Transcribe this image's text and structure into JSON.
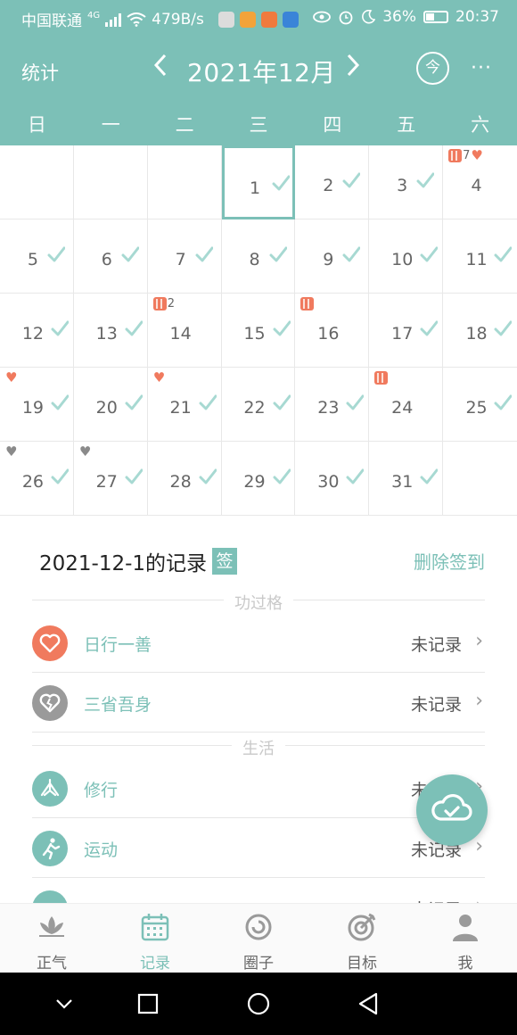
{
  "status_bar": {
    "carrier": "中国联通",
    "network": "4G",
    "speed": "479B/s",
    "battery": "36%",
    "time": "20:37"
  },
  "header": {
    "stats_label": "统计",
    "month_title": "2021年12月",
    "prev_icon": "chevron-left-icon",
    "next_icon": "chevron-right-icon",
    "today_label": "今",
    "more_label": "···"
  },
  "weekdays": [
    "日",
    "一",
    "二",
    "三",
    "四",
    "五",
    "六"
  ],
  "calendar": {
    "days": [
      "",
      "",
      "",
      "1",
      "2",
      "3",
      "4",
      "5",
      "6",
      "7",
      "8",
      "9",
      "10",
      "11",
      "12",
      "13",
      "14",
      "15",
      "16",
      "17",
      "18",
      "19",
      "20",
      "21",
      "22",
      "23",
      "24",
      "25",
      "26",
      "27",
      "28",
      "29",
      "30",
      "31",
      ""
    ],
    "selected_day": "1",
    "marker_counts": {
      "4": "7",
      "14": "2"
    }
  },
  "record": {
    "title": "2021-12-1的记录",
    "sign_badge": "签",
    "delete_label": "删除签到"
  },
  "sections": {
    "merit": "功过格",
    "life": "生活"
  },
  "rows": [
    {
      "label": "日行一善",
      "status": "未记录",
      "icon": "heart-icon"
    },
    {
      "label": "三省吾身",
      "status": "未记录",
      "icon": "broken-heart-icon"
    },
    {
      "label": "修行",
      "status": "未记录",
      "icon": "meditation-icon"
    },
    {
      "label": "运动",
      "status": "未记录",
      "icon": "running-icon"
    },
    {
      "label": "",
      "status": "未记录",
      "icon": "book-icon"
    }
  ],
  "bottom_nav": [
    {
      "label": "正气",
      "icon": "lotus-icon"
    },
    {
      "label": "记录",
      "icon": "calendar-icon"
    },
    {
      "label": "圈子",
      "icon": "circle-icon"
    },
    {
      "label": "目标",
      "icon": "target-icon"
    },
    {
      "label": "我",
      "icon": "person-icon"
    }
  ],
  "colors": {
    "accent": "#7cc0b7",
    "marker": "#f07a5e",
    "gray_icon": "#9a9a9a"
  }
}
